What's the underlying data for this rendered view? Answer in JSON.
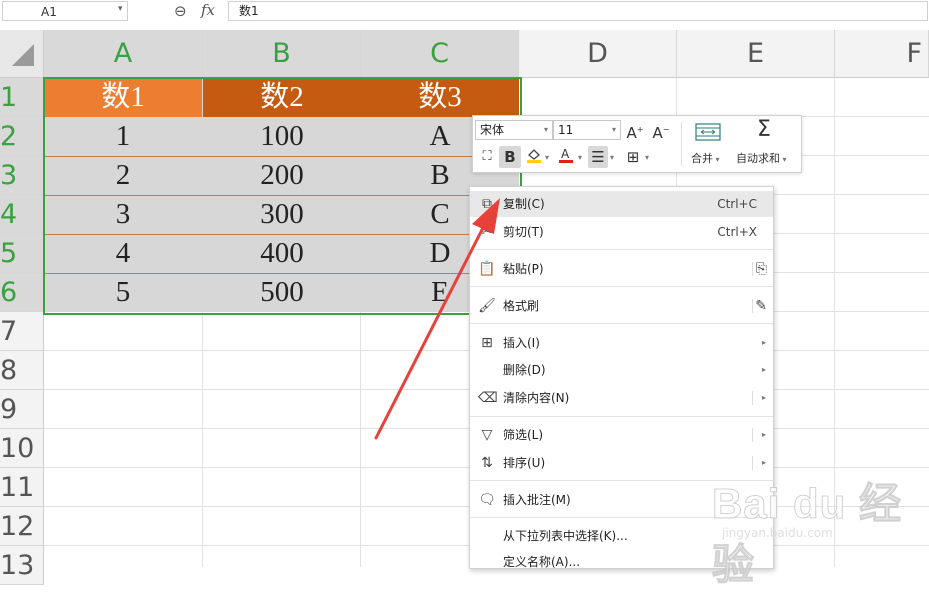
{
  "formula_bar": {
    "cell_ref": "A1",
    "value": "数1"
  },
  "columns": [
    "A",
    "B",
    "C",
    "D",
    "E",
    "F"
  ],
  "rows": [
    "1",
    "2",
    "3",
    "4",
    "5",
    "6",
    "7",
    "8",
    "9",
    "10",
    "11",
    "12",
    "13"
  ],
  "table": {
    "headers": [
      "数1",
      "数2",
      "数3"
    ],
    "rows": [
      [
        "1",
        "100",
        "A"
      ],
      [
        "2",
        "200",
        "B"
      ],
      [
        "3",
        "300",
        "C"
      ],
      [
        "4",
        "400",
        "D"
      ],
      [
        "5",
        "500",
        "E"
      ]
    ]
  },
  "mini_toolbar": {
    "font_name": "宋体",
    "font_size": "11",
    "merge_label": "合并",
    "autosum_label": "自动求和"
  },
  "context_menu": {
    "copy": {
      "label": "复制(C)",
      "shortcut": "Ctrl+C"
    },
    "cut": {
      "label": "剪切(T)",
      "shortcut": "Ctrl+X"
    },
    "paste": {
      "label": "粘贴(P)"
    },
    "format_painter": {
      "label": "格式刷"
    },
    "insert": {
      "label": "插入(I)"
    },
    "delete": {
      "label": "删除(D)"
    },
    "clear": {
      "label": "清除内容(N)"
    },
    "filter": {
      "label": "筛选(L)"
    },
    "sort": {
      "label": "排序(U)"
    },
    "insert_comment": {
      "label": "插入批注(M)"
    },
    "pick_from_list": {
      "label": "从下拉列表中选择(K)..."
    },
    "define_name": {
      "label": "定义名称(A)..."
    }
  },
  "watermark": {
    "main": "Bai du 经验",
    "sub": "jingyan.baidu.com"
  },
  "colors": {
    "header_orange": "#ed7d31",
    "header_dark_orange": "#c55a11",
    "selection_green": "#3aa140",
    "arrow_red": "#e8413a"
  }
}
